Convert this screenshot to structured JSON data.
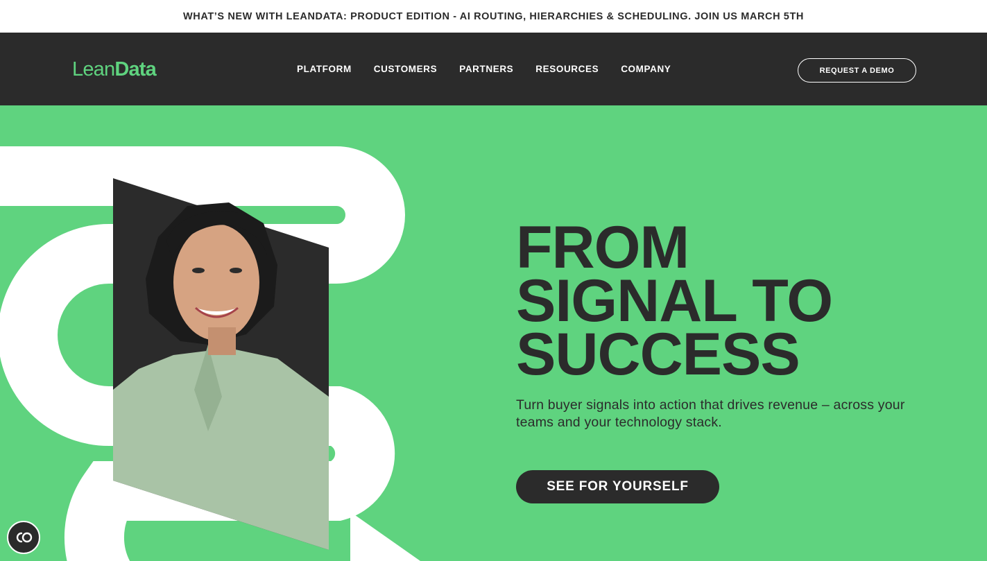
{
  "announcement": {
    "text": "WHAT’S NEW WITH LEANDATA: PRODUCT EDITION - AI ROUTING, HIERARCHIES & SCHEDULING. JOIN US MARCH 5TH"
  },
  "brand": {
    "logo_part1": "Lean",
    "logo_part2": "Data",
    "accent": "#5fd37f",
    "dark": "#2b2b2b"
  },
  "nav": {
    "items": [
      {
        "label": "PLATFORM"
      },
      {
        "label": "CUSTOMERS"
      },
      {
        "label": "PARTNERS"
      },
      {
        "label": "RESOURCES"
      },
      {
        "label": "COMPANY"
      }
    ],
    "demo_label": "REQUEST A DEMO"
  },
  "hero": {
    "headline_lines": [
      "FROM",
      "SIGNAL TO",
      "SUCCESS"
    ],
    "subtext": "Turn buyer signals into action that drives revenue – across your teams and your technology stack.",
    "cta_label": "SEE FOR YOURSELF"
  },
  "icons": {
    "accessibility": "accessibility-toggle-icon",
    "portrait": "person-portrait-image"
  }
}
